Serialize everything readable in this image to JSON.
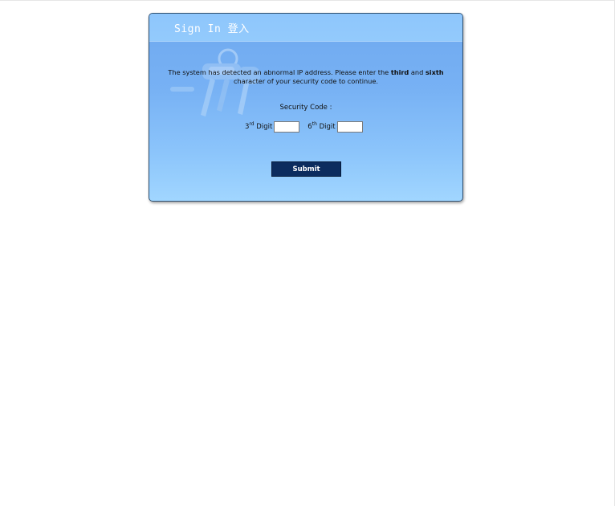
{
  "login": {
    "title": "Sign In 登入",
    "message_pre": "The system has detected an abnormal IP address. Please enter the ",
    "message_third": "third",
    "message_and": " and ",
    "message_sixth": "sixth",
    "message_post": "character of your security code to continue.",
    "security_code_label": "Security Code :",
    "digit_3_number": "3",
    "digit_3_suffix": "rd",
    "digit_6_number": "6",
    "digit_6_suffix": "th",
    "digit_word": " Digit",
    "digit_3_value": "",
    "digit_6_value": "",
    "submit_label": "Submit"
  },
  "colors": {
    "panel_blue": "#77b1f4",
    "header_blue": "#8ec6fc",
    "submit_navy": "#0c2c5e"
  },
  "icons": {
    "background": "keys-icon"
  }
}
